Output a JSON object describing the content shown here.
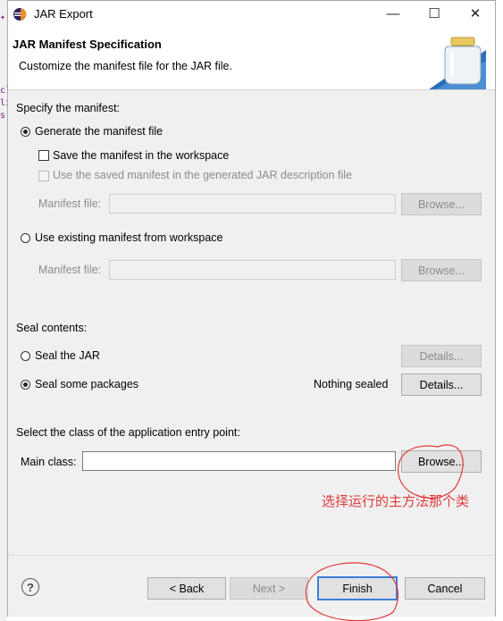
{
  "window": {
    "title": "JAR Export",
    "minimize_glyph": "—",
    "maximize_glyph": "☐",
    "close_glyph": "✕"
  },
  "banner": {
    "title": "JAR Manifest Specification",
    "description": "Customize the manifest file for the JAR file.",
    "icon": "jar-icon"
  },
  "manifest": {
    "section_label": "Specify the manifest:",
    "generate_label": "Generate the manifest file",
    "save_label": "Save the manifest in the workspace",
    "use_saved_label": "Use the saved manifest in the generated JAR description file",
    "file_label_1": "Manifest file:",
    "browse_1": "Browse...",
    "existing_label": "Use existing manifest from workspace",
    "file_label_2": "Manifest file:",
    "browse_2": "Browse..."
  },
  "seal": {
    "section_label": "Seal contents:",
    "seal_jar_label": "Seal the JAR",
    "details_1": "Details...",
    "seal_some_label": "Seal some packages",
    "status": "Nothing sealed",
    "details_2": "Details..."
  },
  "entry": {
    "section_label": "Select the class of the application entry point:",
    "main_class_label": "Main class:",
    "main_class_value": "",
    "browse": "Browse..."
  },
  "annotation": "选择运行的主方法那个类",
  "footer": {
    "help_glyph": "?",
    "back": "< Back",
    "next": "Next >",
    "finish": "Finish",
    "cancel": "Cancel"
  },
  "edge_glyphs": [
    "✦",
    "cl",
    "li",
    "s"
  ],
  "colors": {
    "annotation": "#e03a3a",
    "default_button_border": "#3c7fd6",
    "panel_background": "#f0f0f0"
  }
}
